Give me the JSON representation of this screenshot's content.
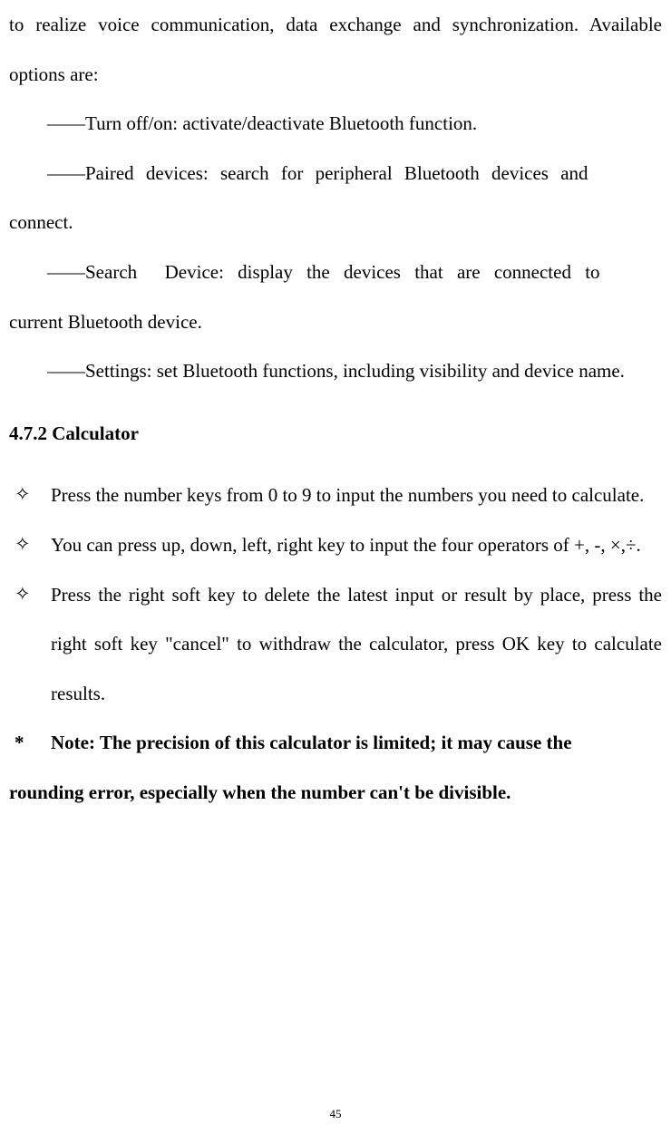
{
  "intro": {
    "p1": "to realize voice communication, data exchange and synchronization. Available options are:",
    "p2": "――Turn off/on: activate/deactivate Bluetooth function.",
    "p3": "――Paired devices: search for peripheral Bluetooth devices and connect.",
    "p4": "――Search  Device: display the devices that are connected to current Bluetooth device.",
    "p5": "――Settings: set Bluetooth functions, including visibility and device name."
  },
  "heading": "4.7.2 Calculator",
  "list": {
    "marker": "✧",
    "items": [
      "Press the number keys from 0 to 9 to input the numbers you need to calculate.",
      "You can press up, down, left, right key to input the four operators of +, -, ×,÷.",
      "Press the right soft key to delete the latest input or result by place, press the right soft key \"cancel\" to withdraw the calculator, press OK key to calculate results."
    ]
  },
  "note": {
    "marker": "*",
    "line1": "Note: The precision of this calculator is limited; it may cause the",
    "line2": "rounding error, especially when the number can't be divisible."
  },
  "pageNumber": "45"
}
